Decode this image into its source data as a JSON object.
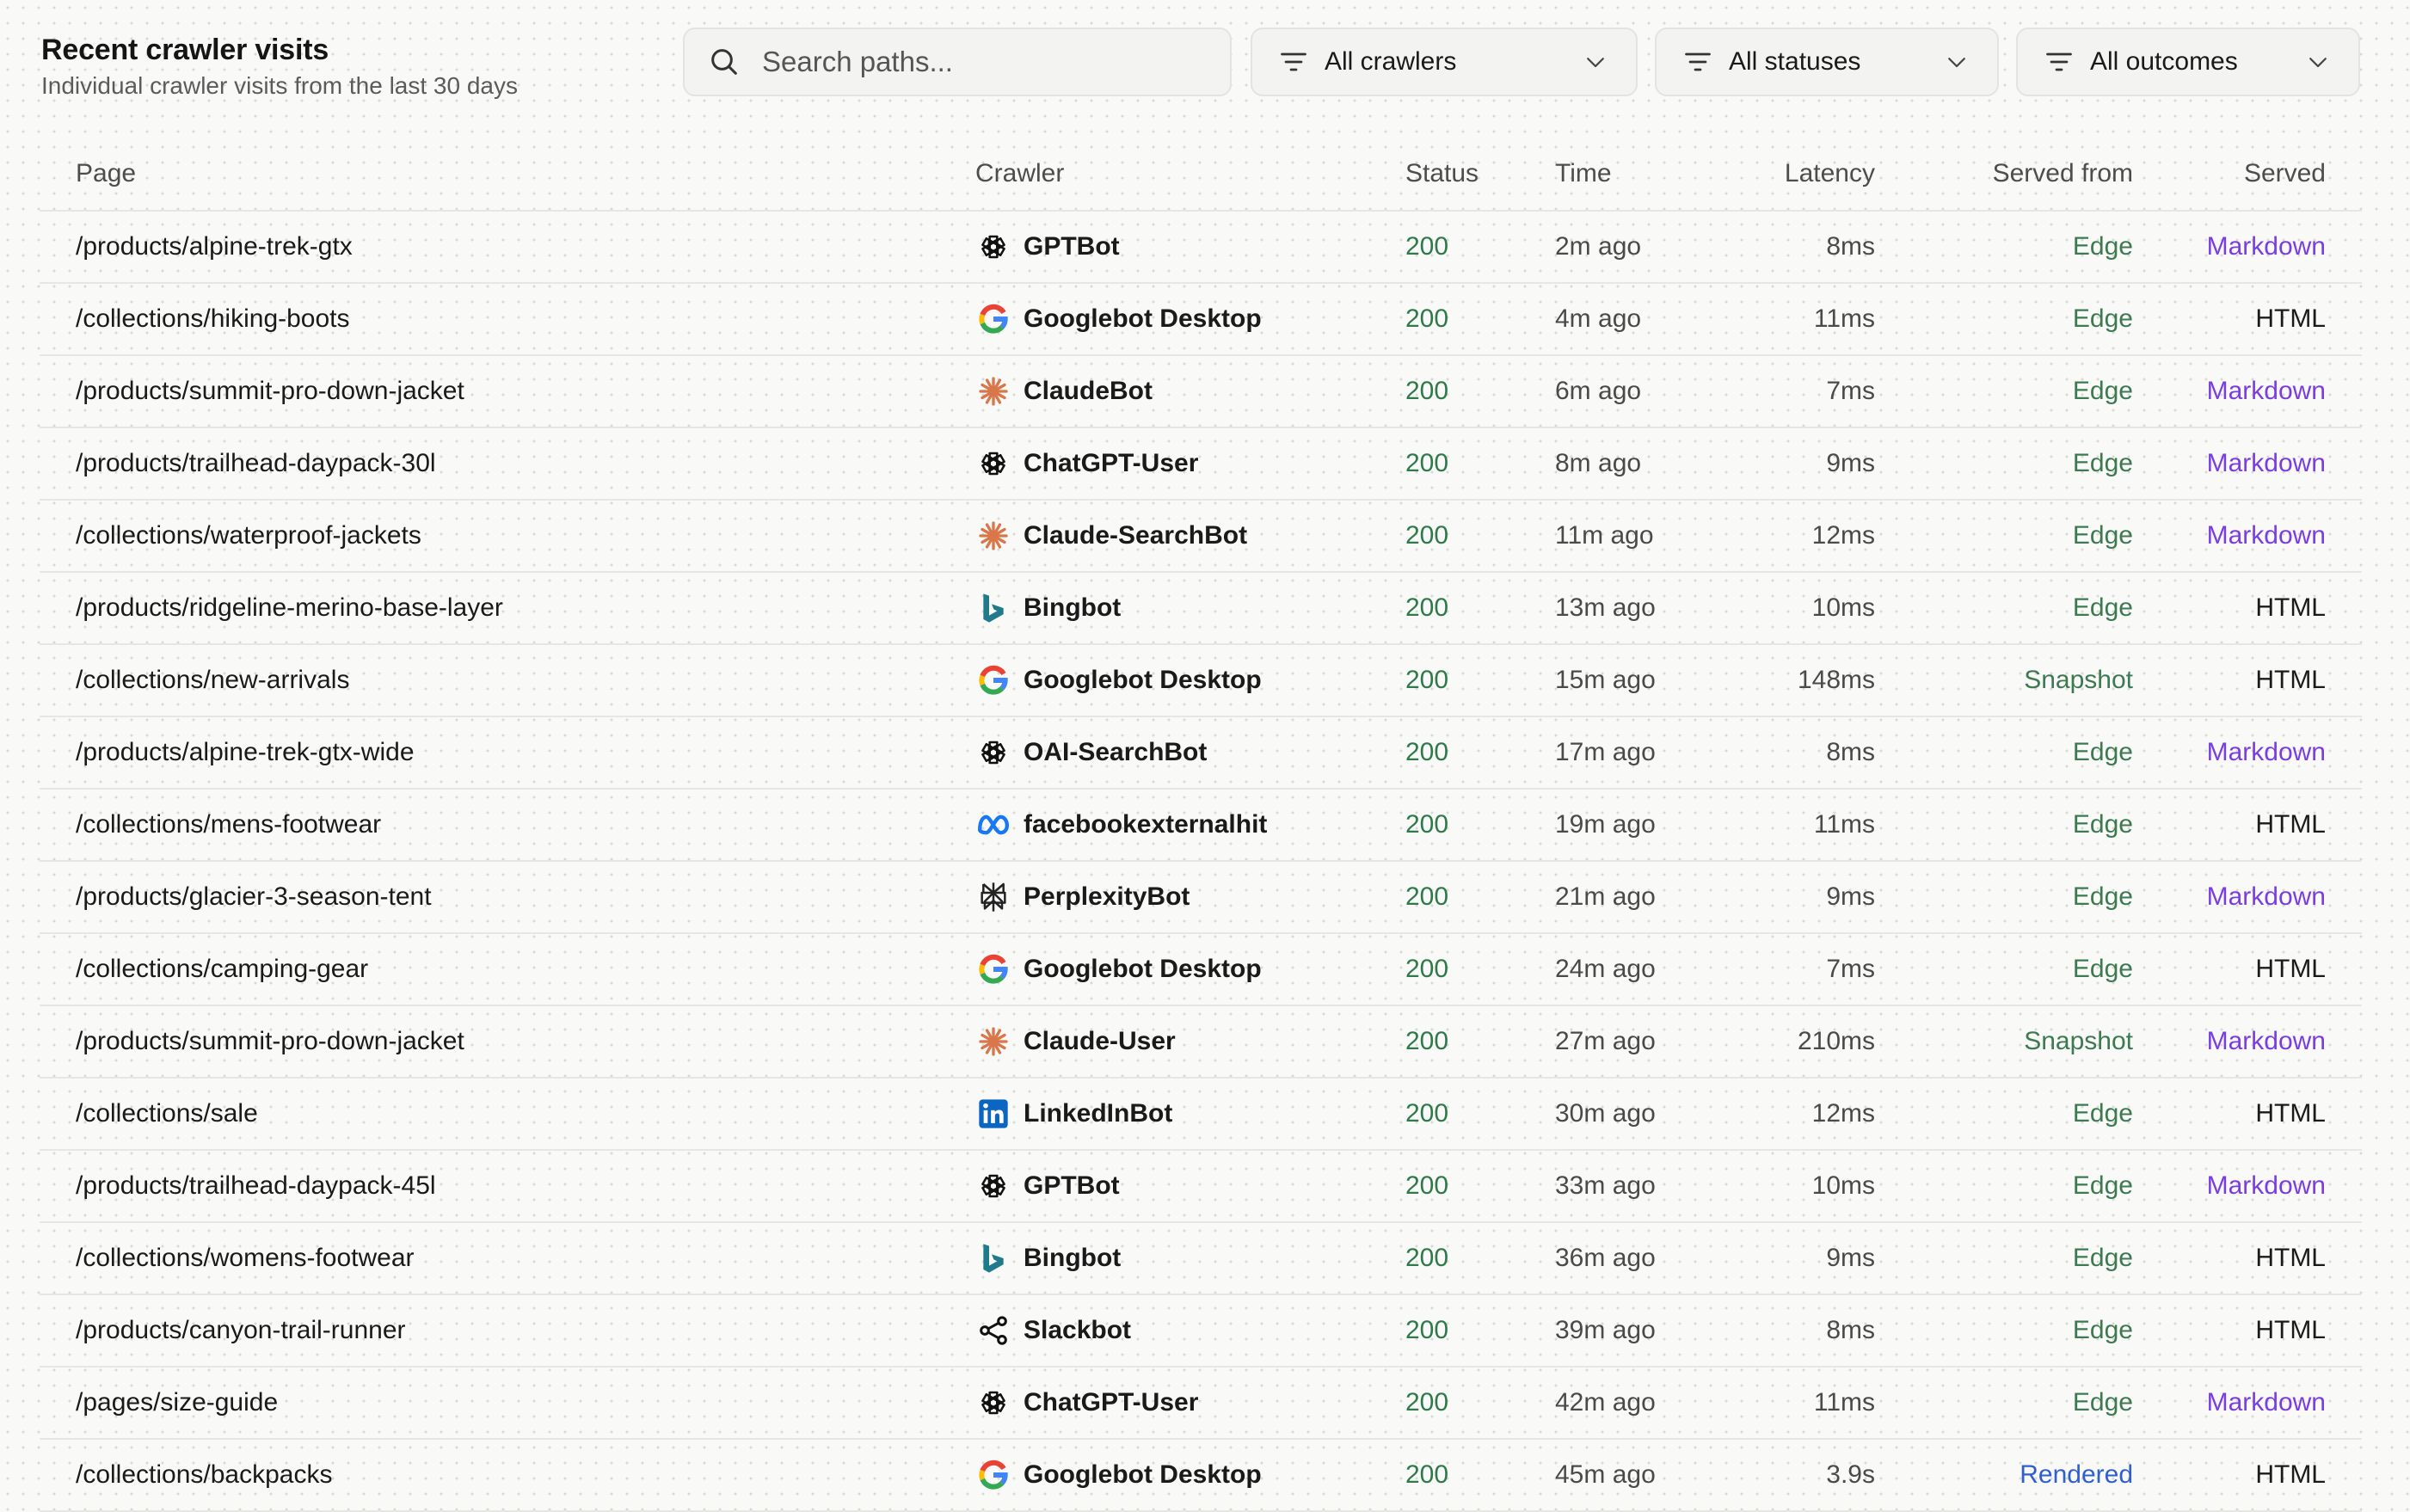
{
  "header": {
    "title": "Recent crawler visits",
    "subtitle": "Individual crawler visits from the last 30 days"
  },
  "search": {
    "placeholder": "Search paths...",
    "value": ""
  },
  "filters": [
    {
      "label": "All crawlers"
    },
    {
      "label": "All statuses"
    },
    {
      "label": "All outcomes"
    }
  ],
  "columns": {
    "page": "Page",
    "crawler": "Crawler",
    "status": "Status",
    "time": "Time",
    "latency": "Latency",
    "served_from": "Served from",
    "served": "Served"
  },
  "colors": {
    "status_ok": "#2f7a4b",
    "edge": "#3d7a52",
    "rendered": "#2f5fd0",
    "markdown": "#7a3de0"
  },
  "rows": [
    {
      "page": "/products/alpine-trek-gtx",
      "crawler": "GPTBot",
      "icon": "openai-icon",
      "status": "200",
      "time": "2m ago",
      "latency": "8ms",
      "served_from": "Edge",
      "served": "Markdown"
    },
    {
      "page": "/collections/hiking-boots",
      "crawler": "Googlebot Desktop",
      "icon": "google-icon",
      "status": "200",
      "time": "4m ago",
      "latency": "11ms",
      "served_from": "Edge",
      "served": "HTML"
    },
    {
      "page": "/products/summit-pro-down-jacket",
      "crawler": "ClaudeBot",
      "icon": "claude-icon",
      "status": "200",
      "time": "6m ago",
      "latency": "7ms",
      "served_from": "Edge",
      "served": "Markdown"
    },
    {
      "page": "/products/trailhead-daypack-30l",
      "crawler": "ChatGPT-User",
      "icon": "openai-icon",
      "status": "200",
      "time": "8m ago",
      "latency": "9ms",
      "served_from": "Edge",
      "served": "Markdown"
    },
    {
      "page": "/collections/waterproof-jackets",
      "crawler": "Claude-SearchBot",
      "icon": "claude-icon",
      "status": "200",
      "time": "11m ago",
      "latency": "12ms",
      "served_from": "Edge",
      "served": "Markdown"
    },
    {
      "page": "/products/ridgeline-merino-base-layer",
      "crawler": "Bingbot",
      "icon": "bing-icon",
      "status": "200",
      "time": "13m ago",
      "latency": "10ms",
      "served_from": "Edge",
      "served": "HTML"
    },
    {
      "page": "/collections/new-arrivals",
      "crawler": "Googlebot Desktop",
      "icon": "google-icon",
      "status": "200",
      "time": "15m ago",
      "latency": "148ms",
      "served_from": "Snapshot",
      "served": "HTML"
    },
    {
      "page": "/products/alpine-trek-gtx-wide",
      "crawler": "OAI-SearchBot",
      "icon": "openai-icon",
      "status": "200",
      "time": "17m ago",
      "latency": "8ms",
      "served_from": "Edge",
      "served": "Markdown"
    },
    {
      "page": "/collections/mens-footwear",
      "crawler": "facebookexternalhit",
      "icon": "meta-icon",
      "status": "200",
      "time": "19m ago",
      "latency": "11ms",
      "served_from": "Edge",
      "served": "HTML"
    },
    {
      "page": "/products/glacier-3-season-tent",
      "crawler": "PerplexityBot",
      "icon": "perplexity-icon",
      "status": "200",
      "time": "21m ago",
      "latency": "9ms",
      "served_from": "Edge",
      "served": "Markdown"
    },
    {
      "page": "/collections/camping-gear",
      "crawler": "Googlebot Desktop",
      "icon": "google-icon",
      "status": "200",
      "time": "24m ago",
      "latency": "7ms",
      "served_from": "Edge",
      "served": "HTML"
    },
    {
      "page": "/products/summit-pro-down-jacket",
      "crawler": "Claude-User",
      "icon": "claude-icon",
      "status": "200",
      "time": "27m ago",
      "latency": "210ms",
      "served_from": "Snapshot",
      "served": "Markdown"
    },
    {
      "page": "/collections/sale",
      "crawler": "LinkedInBot",
      "icon": "linkedin-icon",
      "status": "200",
      "time": "30m ago",
      "latency": "12ms",
      "served_from": "Edge",
      "served": "HTML"
    },
    {
      "page": "/products/trailhead-daypack-45l",
      "crawler": "GPTBot",
      "icon": "openai-icon",
      "status": "200",
      "time": "33m ago",
      "latency": "10ms",
      "served_from": "Edge",
      "served": "Markdown"
    },
    {
      "page": "/collections/womens-footwear",
      "crawler": "Bingbot",
      "icon": "bing-icon",
      "status": "200",
      "time": "36m ago",
      "latency": "9ms",
      "served_from": "Edge",
      "served": "HTML"
    },
    {
      "page": "/products/canyon-trail-runner",
      "crawler": "Slackbot",
      "icon": "share-icon",
      "status": "200",
      "time": "39m ago",
      "latency": "8ms",
      "served_from": "Edge",
      "served": "HTML"
    },
    {
      "page": "/pages/size-guide",
      "crawler": "ChatGPT-User",
      "icon": "openai-icon",
      "status": "200",
      "time": "42m ago",
      "latency": "11ms",
      "served_from": "Edge",
      "served": "Markdown"
    },
    {
      "page": "/collections/backpacks",
      "crawler": "Googlebot Desktop",
      "icon": "google-icon",
      "status": "200",
      "time": "45m ago",
      "latency": "3.9s",
      "served_from": "Rendered",
      "served": "HTML"
    }
  ]
}
